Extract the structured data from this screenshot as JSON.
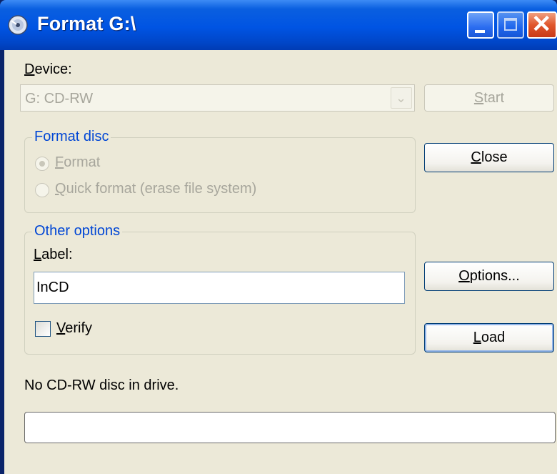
{
  "window": {
    "title": "Format G:\\",
    "min_label": "Minimize",
    "max_label": "Maximize",
    "close_glyph": "✕"
  },
  "device": {
    "label_prefix": "D",
    "label_rest": "evice:",
    "selected": "G: CD-RW",
    "dropdown_glyph": "⌄"
  },
  "buttons": {
    "start_prefix": "S",
    "start_rest": "tart",
    "close_prefix": "C",
    "close_rest": "lose",
    "options_prefix": "O",
    "options_rest": "ptions...",
    "load_prefix": "L",
    "load_rest": "oad"
  },
  "format_disc": {
    "legend": "Format disc",
    "format_prefix": "F",
    "format_rest": "ormat",
    "quick_prefix": "Q",
    "quick_rest": "uick format (erase file system)"
  },
  "other_options": {
    "legend": "Other options",
    "label_prefix": "L",
    "label_rest": "abel:",
    "label_value": "InCD",
    "verify_prefix": "V",
    "verify_rest": "erify"
  },
  "status": {
    "text": "No CD-RW disc in drive.",
    "progress": 0
  }
}
